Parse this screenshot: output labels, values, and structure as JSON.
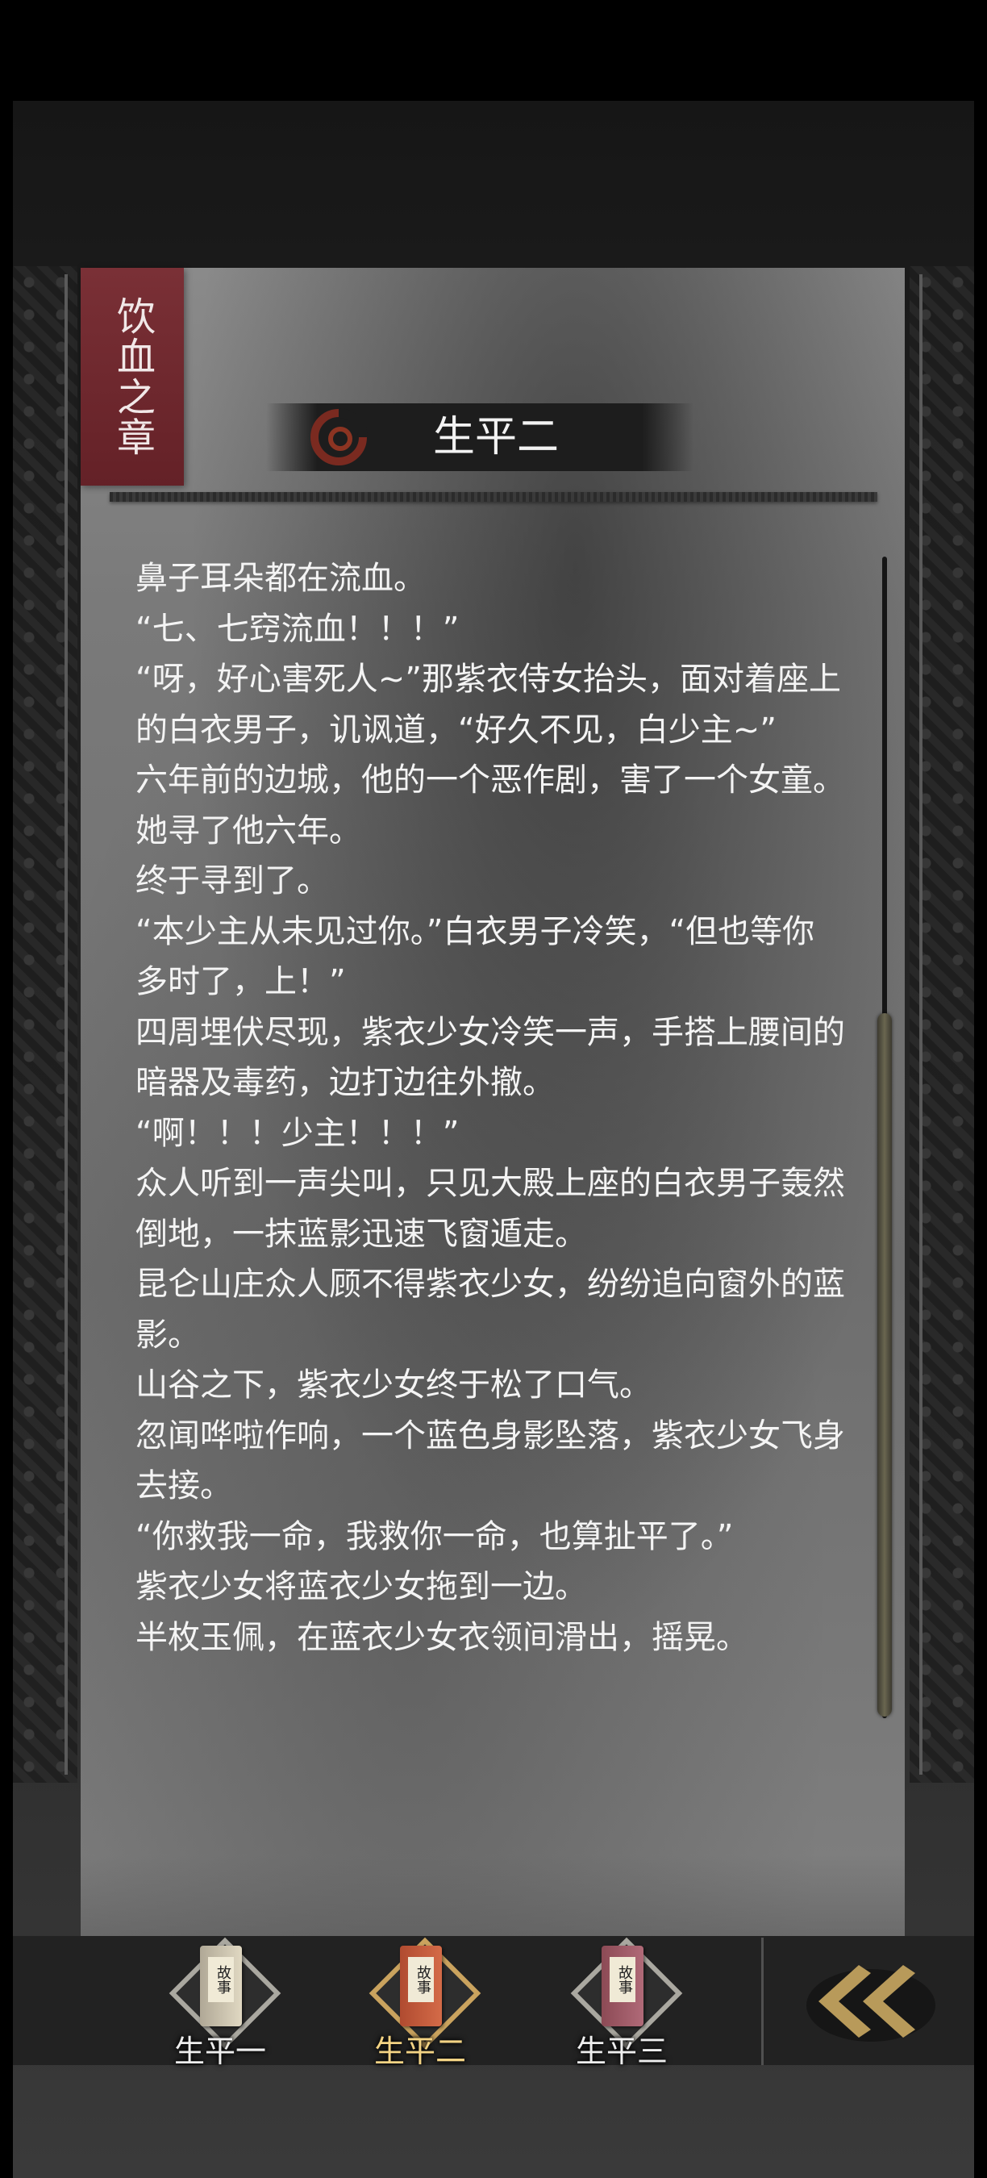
{
  "chapter_tag": "饮血之章",
  "chapter_title": "生平二",
  "content": [
    "鼻子耳朵都在流血。",
    "“七、七窍流血！！！”",
    "“呀，好心害死人~”那紫衣侍女抬头，面对着座上的白衣男子，讥讽道，“好久不见，白少主~”",
    "六年前的边城，他的一个恶作剧，害了一个女童。",
    "她寻了他六年。",
    "终于寻到了。",
    "“本少主从未见过你。”白衣男子冷笑，“但也等你多时了，上！”",
    "四周埋伏尽现，紫衣少女冷笑一声，手搭上腰间的暗器及毒药，边打边往外撤。",
    "“啊！！！少主！！！”",
    "众人听到一声尖叫，只见大殿上座的白衣男子轰然倒地，一抹蓝影迅速飞窗遁走。",
    "昆仑山庄众人顾不得紫衣少女，纷纷追向窗外的蓝影。",
    "山谷之下，紫衣少女终于松了口气。",
    "忽闻哗啦作响，一个蓝色身影坠落，紫衣少女飞身去接。",
    "“你救我一命，我救你一命，也算扯平了。”",
    "紫衣少女将蓝衣少女拖到一边。",
    "半枚玉佩，在蓝衣少女衣领间滑出，摇晃。"
  ],
  "nav": {
    "items": [
      {
        "label": "生平一",
        "active": false
      },
      {
        "label": "生平二",
        "active": true
      },
      {
        "label": "生平三",
        "active": false
      }
    ],
    "back_icon": "double-chevron-left-icon"
  },
  "colors": {
    "chapter_tag_bg": "#6e262c",
    "active_label": "#f3d384",
    "back_gold": "#b89a5a"
  }
}
